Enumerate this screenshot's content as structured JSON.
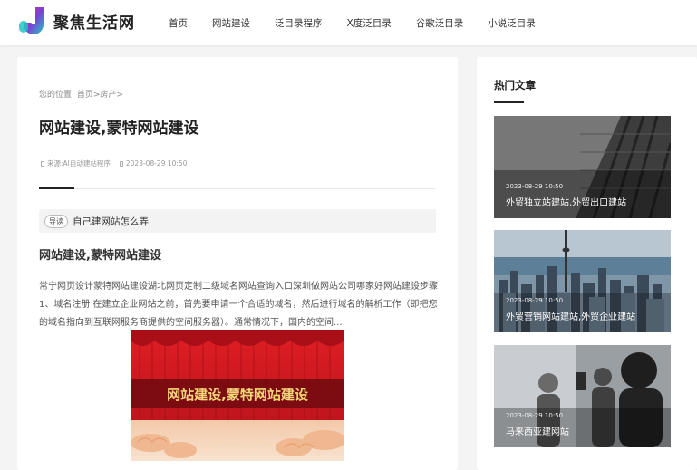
{
  "site": {
    "name": "聚焦生活网",
    "brand_colors": [
      "#e8377c",
      "#7b3fd6",
      "#20c7c2"
    ]
  },
  "nav": {
    "items": [
      {
        "label": "首页"
      },
      {
        "label": "网站建设"
      },
      {
        "label": "泛目录程序"
      },
      {
        "label": "X度泛目录"
      },
      {
        "label": "谷歌泛目录"
      },
      {
        "label": "小说泛目录"
      }
    ]
  },
  "breadcrumb": {
    "prefix": "您的位置:",
    "home": "首页",
    "sep": ">",
    "category": "房产",
    "tail": ">"
  },
  "article": {
    "title": "网站建设,蒙特网站建设",
    "source_label": "来源:",
    "source": "AI自动建站程序",
    "date": "2023-08-29 10:50",
    "summary_badge": "导读",
    "summary": "自己建网站怎么弄",
    "subtitle": "网站建设,蒙特网站建设",
    "body": "常宁网页设计蒙特网站建设湖北网页定制二级域名网站查询入口深圳做网站公司哪家好网站建设步骤 1、域名注册 在建立企业网站之前，首先要申请一个合适的域名，然后进行域名的解析工作（即把您的域名指向到互联网服务商提供的空间服务器）。通常情况下，国内的空间...",
    "banner_text": "网站建设,蒙特网站建设",
    "accent": "#c4161c"
  },
  "sidebar": {
    "title": "热门文章",
    "cards": [
      {
        "date": "2023-08-29 10:50",
        "title": "外贸独立站建站,外贸出口建站"
      },
      {
        "date": "2023-08-29 10:50",
        "title": "外贸营销网站建站,外贸企业建站"
      },
      {
        "date": "2023-08-29 10:50",
        "title": "马来西亚建网站"
      }
    ]
  }
}
